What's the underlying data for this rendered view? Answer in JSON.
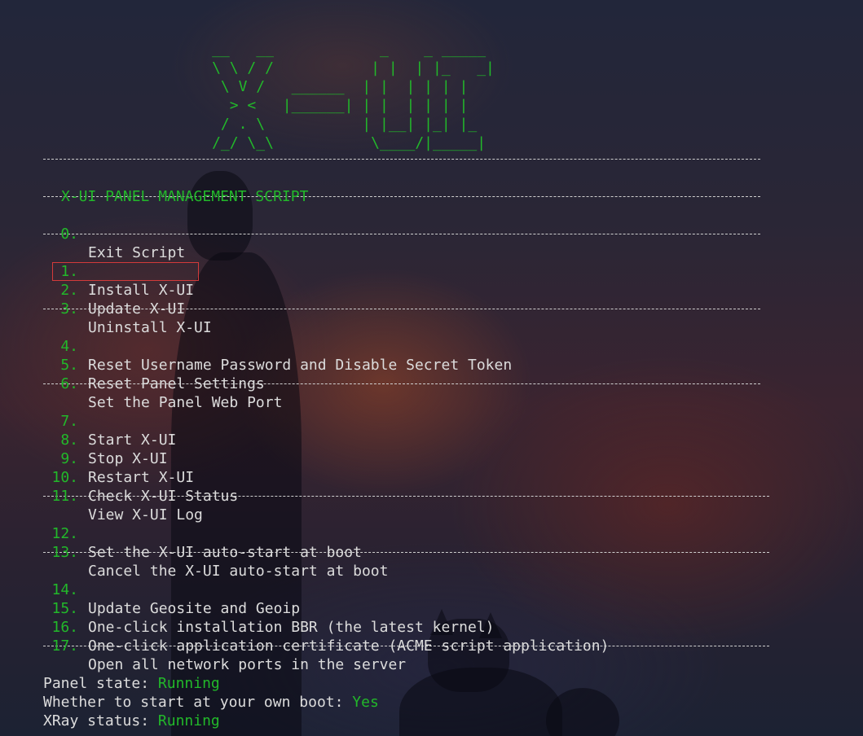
{
  "logo_lines": [
    "                        __   __            _    _ _____",
    "                        \\ \\ / /           | |  | |_   _|",
    "                         \\ V /   ______  | |  | | | |",
    "                          > <   |______| | |  | | | |",
    "                         / . \\           | |__| |_| |_",
    "                        /_/ \\_\\           \\____/|_____|"
  ],
  "header": {
    "title": "X-UI PANEL MANAGEMENT SCRIPT"
  },
  "menu": [
    {
      "num": "0.",
      "label": "Exit Script"
    },
    {
      "num": "1.",
      "label": "Install X-UI"
    },
    {
      "num": "2.",
      "label": "Update X-UI"
    },
    {
      "num": "3.",
      "label": "Uninstall X-UI"
    },
    {
      "num": "4.",
      "label": "Reset Username Password and Disable Secret Token"
    },
    {
      "num": "5.",
      "label": "Reset Panel Settings"
    },
    {
      "num": "6.",
      "label": "Set the Panel Web Port"
    },
    {
      "num": "7.",
      "label": "Start X-UI"
    },
    {
      "num": "8.",
      "label": "Stop X-UI"
    },
    {
      "num": "9.",
      "label": "Restart X-UI"
    },
    {
      "num": "10.",
      "label": "Check X-UI Status"
    },
    {
      "num": "11.",
      "label": "View X-UI Log"
    },
    {
      "num": "12.",
      "label": "Set the X-UI auto-start at boot"
    },
    {
      "num": "13.",
      "label": "Cancel the X-UI auto-start at boot"
    },
    {
      "num": "14.",
      "label": "Update Geosite and Geoip"
    },
    {
      "num": "15.",
      "label": "One-click installation BBR (the latest kernel)"
    },
    {
      "num": "16.",
      "label": "One-click application certificate (ACME script application)"
    },
    {
      "num": "17.",
      "label": "Open all network ports in the server"
    }
  ],
  "status": {
    "panel_label": "Panel state: ",
    "panel_value": "Running",
    "boot_label": "Whether to start at your own boot: ",
    "boot_value": "Yes",
    "xray_label": "XRay status: ",
    "xray_value": "Running"
  },
  "colors": {
    "accent_green": "#22b82a",
    "text": "#dcdcdc",
    "highlight_border": "#d33a3a"
  }
}
